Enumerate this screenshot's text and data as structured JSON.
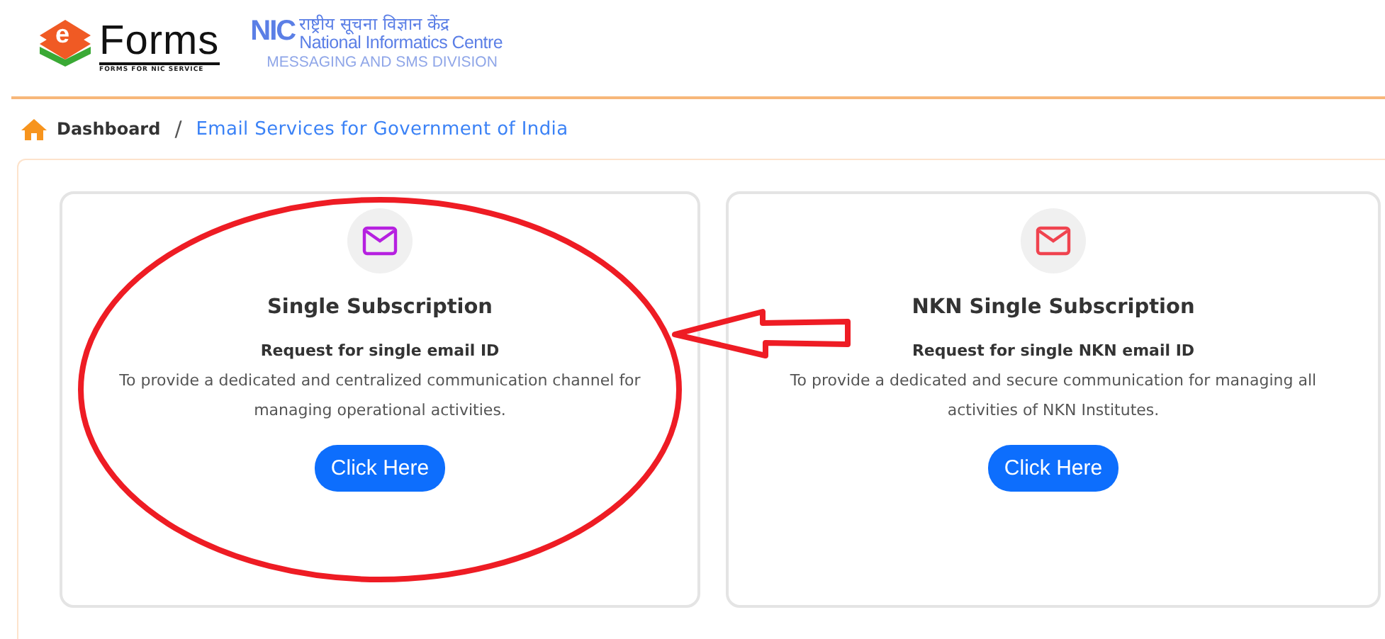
{
  "header": {
    "eforms_logo": {
      "letter": "e",
      "name": "Forms",
      "tagline": "FORMS FOR NIC SERVICE"
    },
    "nic_logo": {
      "mark": "NIC",
      "hindi": "राष्ट्रीय सूचना विज्ञान केंद्र",
      "name": "National Informatics Centre",
      "division": "MESSAGING AND SMS DIVISION"
    }
  },
  "breadcrumb": [
    {
      "label": "Dashboard",
      "selected": false
    },
    {
      "label": "Email Services for Government of India",
      "selected": true
    }
  ],
  "breadcrumb_separator": "/",
  "cards": [
    {
      "title": "Single Subscription",
      "subtitle": "Request for single email ID",
      "description": "To provide a dedicated and centralized communication channel for managing operational activities.",
      "button": "Click Here",
      "color": "#b620e0"
    },
    {
      "title": "NKN Single Subscription",
      "subtitle": "Request for single NKN email ID",
      "description": "To provide a dedicated and secure communication for managing all activities of NKN Institutes.",
      "button": "Click Here",
      "color": "#f0434f"
    }
  ]
}
